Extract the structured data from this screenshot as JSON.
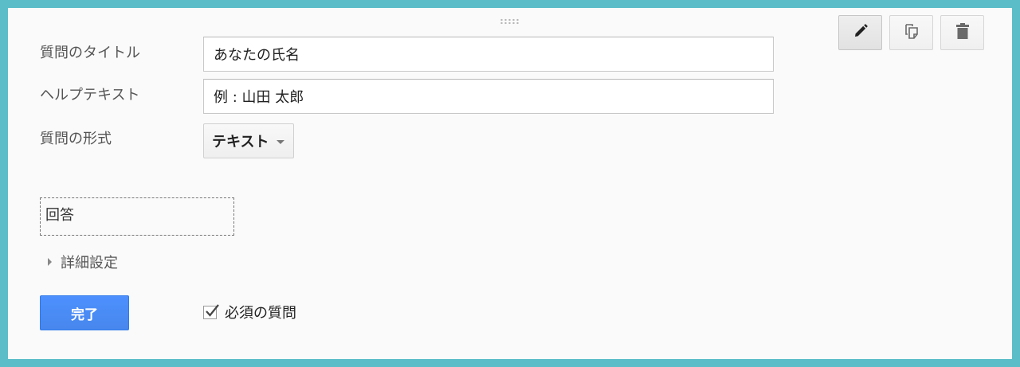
{
  "form": {
    "title_label": "質問のタイトル",
    "title_value": "あなたの氏名",
    "help_label": "ヘルプテキスト",
    "help_value": "例 : 山田 太郎",
    "type_label": "質問の形式",
    "type_value": "テキスト",
    "answer_preview": "回答",
    "advanced_label": "詳細設定",
    "done_label": "完了",
    "required_label": "必須の質問",
    "required_checked": true
  },
  "toolbar": {
    "items": [
      {
        "icon": "pencil-icon",
        "active": true
      },
      {
        "icon": "duplicate-icon",
        "active": false
      },
      {
        "icon": "trash-icon",
        "active": false
      }
    ]
  },
  "colors": {
    "frame": "#5bbdc8",
    "card": "#fafafa",
    "primary": "#4d90fe"
  }
}
